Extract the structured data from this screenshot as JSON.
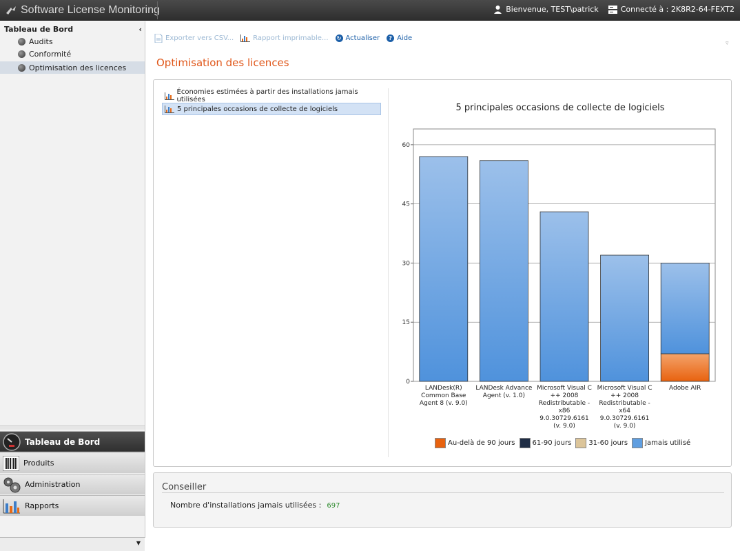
{
  "app": {
    "title": "Software License Monitoring"
  },
  "header": {
    "welcome": "Bienvenue, TEST\\patrick",
    "connected": "Connecté à : 2K8R2-64-FEXT2"
  },
  "sidebar": {
    "heading": "Tableau de Bord",
    "collapse": "‹",
    "items": [
      {
        "label": "Audits"
      },
      {
        "label": "Conformité"
      },
      {
        "label": "Optimisation des licences"
      }
    ],
    "nav": [
      {
        "label": "Tableau de Bord"
      },
      {
        "label": "Produits"
      },
      {
        "label": "Administration"
      },
      {
        "label": "Rapports"
      }
    ]
  },
  "toolbar": {
    "export": "Exporter vers CSV...",
    "print": "Rapport imprimable...",
    "refresh": "Actualiser",
    "help": "Aide"
  },
  "page": {
    "title": "Optimisation des licences"
  },
  "reports": [
    {
      "label": "Économies estimées à partir des installations jamais utilisées"
    },
    {
      "label": "5 principales occasions de collecte de logiciels"
    }
  ],
  "chart_data": {
    "type": "bar",
    "stacked": true,
    "title": "5 principales occasions de collecte de logiciels",
    "categories": [
      [
        "LANDesk(R)",
        "Common Base",
        "Agent 8 (v. 9.0)"
      ],
      [
        "LANDesk Advance",
        "Agent (v. 1.0)"
      ],
      [
        "Microsoft Visual C",
        "++ 2008",
        "Redistributable -",
        "x86",
        "9.0.30729.6161",
        "(v. 9.0)"
      ],
      [
        "Microsoft Visual C",
        "++ 2008",
        "Redistributable -",
        "x64",
        "9.0.30729.6161",
        "(v. 9.0)"
      ],
      [
        "Adobe AIR"
      ]
    ],
    "yticks": [
      "0",
      "15",
      "30",
      "45",
      "60"
    ],
    "ylim": [
      0,
      64
    ],
    "series": [
      {
        "name": "Au-delà de 90 jours",
        "color": "#e8620f",
        "values": [
          0,
          0,
          0,
          0,
          7
        ]
      },
      {
        "name": "61-90 jours",
        "color": "#1f2d45",
        "values": [
          0,
          0,
          0,
          0,
          0
        ]
      },
      {
        "name": "31-60 jours",
        "color": "#dcc59a",
        "values": [
          0,
          0,
          0,
          0,
          0
        ]
      },
      {
        "name": "Jamais utilisé",
        "color": "#5f9ee0",
        "values": [
          57,
          56,
          43,
          32,
          23
        ]
      }
    ],
    "legend_position": "bottom",
    "grid": true
  },
  "advisor": {
    "title": "Conseiller",
    "label": "Nombre d'installations jamais utilisées :",
    "value": "697"
  }
}
